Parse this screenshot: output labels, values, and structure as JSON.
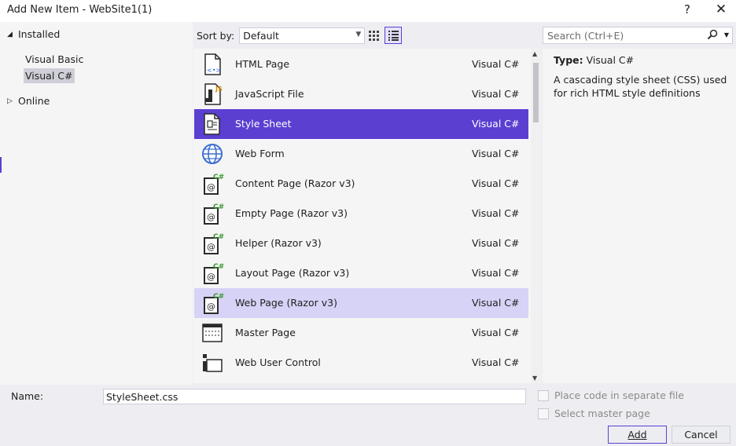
{
  "window": {
    "title": "Add New Item - WebSite1(1)",
    "help_label": "?",
    "close_label": "✕"
  },
  "left": {
    "installed_label": "Installed",
    "templates": [
      {
        "label": "Visual Basic",
        "selected": false
      },
      {
        "label": "Visual C#",
        "selected": true
      }
    ],
    "online_label": "Online"
  },
  "sort": {
    "label": "Sort by:",
    "value": "Default"
  },
  "search": {
    "placeholder": "Search (Ctrl+E)"
  },
  "items": [
    {
      "name": "HTML Page",
      "lang": "Visual C#",
      "icon": "html-page-icon",
      "state": "normal"
    },
    {
      "name": "JavaScript File",
      "lang": "Visual C#",
      "icon": "javascript-file-icon",
      "state": "normal"
    },
    {
      "name": "Style Sheet",
      "lang": "Visual C#",
      "icon": "style-sheet-icon",
      "state": "selected"
    },
    {
      "name": "Web Form",
      "lang": "Visual C#",
      "icon": "globe-icon",
      "state": "normal"
    },
    {
      "name": "Content Page (Razor v3)",
      "lang": "Visual C#",
      "icon": "razor-page-icon",
      "state": "normal"
    },
    {
      "name": "Empty Page (Razor v3)",
      "lang": "Visual C#",
      "icon": "razor-page-icon",
      "state": "normal"
    },
    {
      "name": "Helper (Razor v3)",
      "lang": "Visual C#",
      "icon": "razor-page-icon",
      "state": "normal"
    },
    {
      "name": "Layout Page (Razor v3)",
      "lang": "Visual C#",
      "icon": "razor-page-icon",
      "state": "normal"
    },
    {
      "name": "Web Page (Razor v3)",
      "lang": "Visual C#",
      "icon": "razor-page-icon",
      "state": "hover"
    },
    {
      "name": "Master Page",
      "lang": "Visual C#",
      "icon": "master-page-icon",
      "state": "normal"
    },
    {
      "name": "Web User Control",
      "lang": "Visual C#",
      "icon": "user-control-icon",
      "state": "normal"
    }
  ],
  "info": {
    "type_label": "Type:",
    "type_value": "Visual C#",
    "description": "A cascading style sheet (CSS) used for rich HTML style definitions"
  },
  "bottom": {
    "name_label": "Name:",
    "name_value": "StyleSheet.css",
    "place_code_label": "Place code in separate file",
    "master_page_label": "Select master page",
    "add_label": "Add",
    "cancel_label": "Cancel"
  },
  "colors": {
    "accent": "#5b3fd1",
    "hover": "#d6d3f7",
    "panel": "#f5f5f5",
    "background": "#eeeef2"
  }
}
